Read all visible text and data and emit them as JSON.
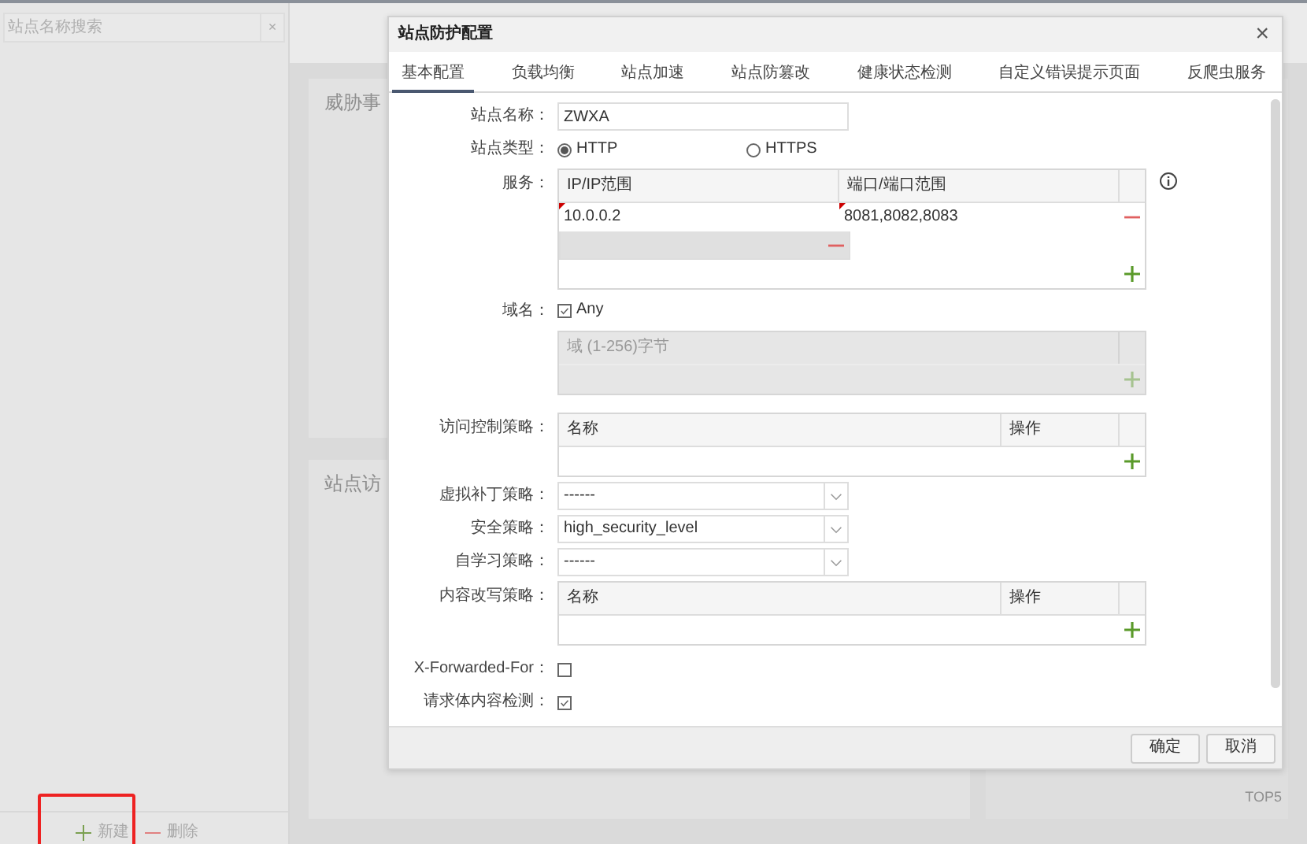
{
  "sidebar": {
    "search": {
      "placeholder": "站点名称搜索",
      "clear": "×"
    },
    "actions": [
      {
        "kind": "add",
        "label": "新建",
        "highlighted": true
      },
      {
        "kind": "remove",
        "label": "删除",
        "highlighted": false
      }
    ]
  },
  "background_panels": [
    {
      "title": "威胁事"
    },
    {
      "title": "站点访"
    },
    {
      "title": "TOP5"
    }
  ],
  "dialog": {
    "title": "站点防护配置",
    "close": "×",
    "tabs": [
      {
        "label": "基本配置",
        "selected": true
      },
      {
        "label": "负载均衡",
        "selected": false
      },
      {
        "label": "站点加速",
        "selected": false
      },
      {
        "label": "站点防篡改",
        "selected": false
      },
      {
        "label": "健康状态检测",
        "selected": false
      },
      {
        "label": "自定义错误提示页面",
        "selected": false
      },
      {
        "label": "反爬虫服务",
        "selected": false
      }
    ],
    "fields": [
      {
        "kind": "text",
        "label": "站点名称：",
        "value": "ZWXA"
      },
      {
        "kind": "radio",
        "label": "站点类型：",
        "options": [
          {
            "label": "HTTP",
            "selected": true
          },
          {
            "label": "HTTPS",
            "selected": false
          }
        ]
      },
      {
        "kind": "service-table",
        "label": "服务：",
        "info": true,
        "columns": [
          "IP/IP范围",
          "端口/端口范围"
        ],
        "rows": [
          {
            "cells": [
              "10.0.0.2",
              "8081,8082,8083"
            ],
            "selected": false,
            "flagged": true
          },
          {
            "selected": true,
            "flagged": false
          }
        ]
      },
      {
        "kind": "domain",
        "label": "域名：",
        "any": {
          "label": "Any",
          "checked": true
        },
        "placeholder": "域 (1-256)字节",
        "disabled": true
      },
      {
        "kind": "policy-table",
        "label": "访问控制策略：",
        "columns": [
          "名称",
          "操作"
        ]
      },
      {
        "kind": "select",
        "label": "虚拟补丁策略：",
        "value": "------"
      },
      {
        "kind": "select",
        "label": "安全策略：",
        "value": "high_security_level"
      },
      {
        "kind": "select",
        "label": "自学习策略：",
        "value": "------"
      },
      {
        "kind": "policy-table",
        "label": "内容改写策略：",
        "columns": [
          "名称",
          "操作"
        ]
      },
      {
        "kind": "checkbox",
        "label": "X-Forwarded-For：",
        "checked": false
      },
      {
        "kind": "checkbox",
        "label": "请求体内容检测：",
        "checked": true
      }
    ],
    "buttons": [
      "确定",
      "取消"
    ]
  }
}
